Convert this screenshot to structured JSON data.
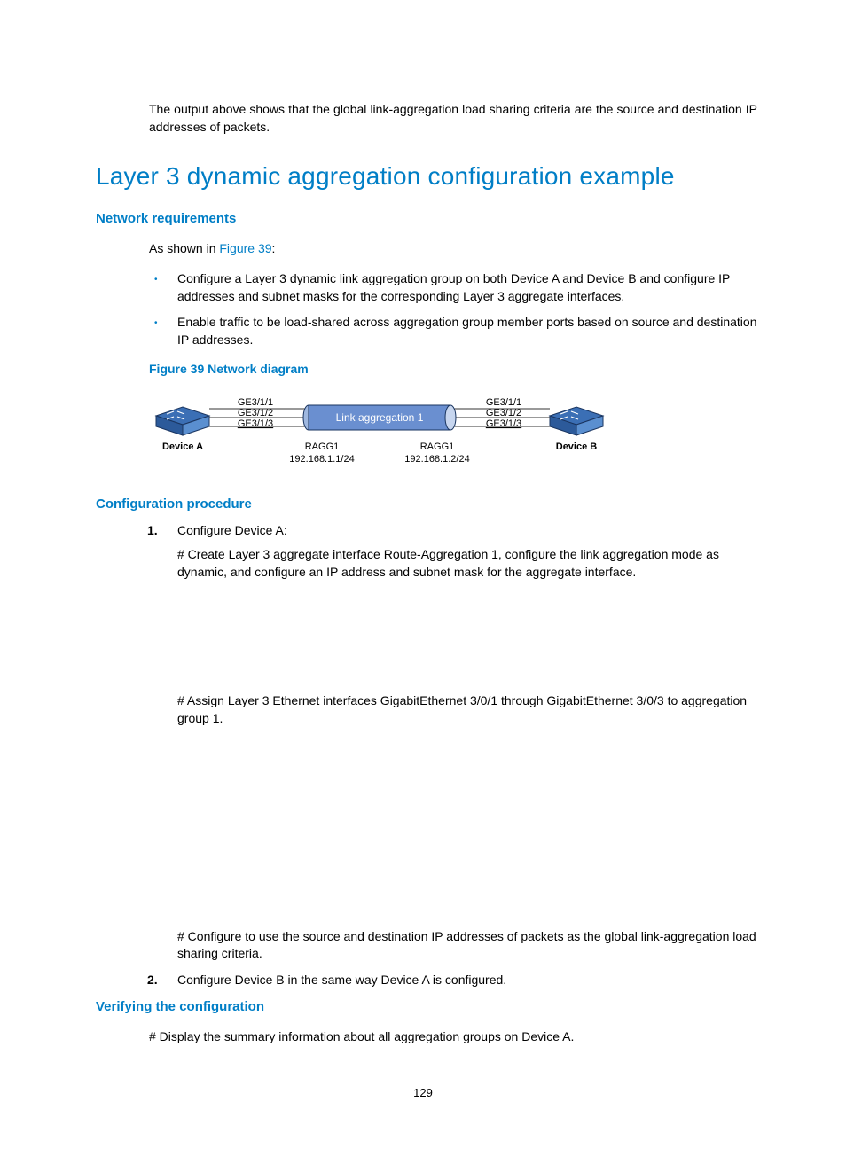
{
  "intro": "The output above shows that the global link-aggregation load sharing criteria are the source and destination IP addresses of packets.",
  "h1": "Layer 3 dynamic aggregation configuration example",
  "req": {
    "heading": "Network requirements",
    "lead_pre": "As shown in ",
    "lead_ref": "Figure 39",
    "lead_post": ":",
    "bullets": [
      "Configure a Layer 3 dynamic link aggregation group on both Device A and Device B and configure IP addresses and subnet masks for the corresponding Layer 3 aggregate interfaces.",
      "Enable traffic to be load-shared across aggregation group member ports based on source and destination IP addresses."
    ]
  },
  "figure": {
    "caption": "Figure 39 Network diagram",
    "left_device": "Device A",
    "right_device": "Device B",
    "ports_left": [
      "GE3/1/1",
      "GE3/1/2",
      "GE3/1/3"
    ],
    "ports_right": [
      "GE3/1/1",
      "GE3/1/2",
      "GE3/1/3"
    ],
    "link_label": "Link aggregation 1",
    "ragg_left_name": "RAGG1",
    "ragg_left_ip": "192.168.1.1/24",
    "ragg_right_name": "RAGG1",
    "ragg_right_ip": "192.168.1.2/24"
  },
  "proc": {
    "heading": "Configuration procedure",
    "step1_title": "Configure Device A:",
    "step1_p1": "# Create Layer 3 aggregate interface Route-Aggregation 1, configure the link aggregation mode as dynamic, and configure an IP address and subnet mask for the aggregate interface.",
    "step1_p2": "# Assign Layer 3 Ethernet interfaces GigabitEthernet 3/0/1 through GigabitEthernet 3/0/3 to aggregation group 1.",
    "step1_p3": "# Configure to use the source and destination IP addresses of packets as the global link-aggregation load sharing criteria.",
    "step2": "Configure Device B in the same way Device A is configured."
  },
  "verify": {
    "heading": "Verifying the configuration",
    "p1": "# Display the summary information about all aggregation groups on Device A."
  },
  "pagenum": "129"
}
